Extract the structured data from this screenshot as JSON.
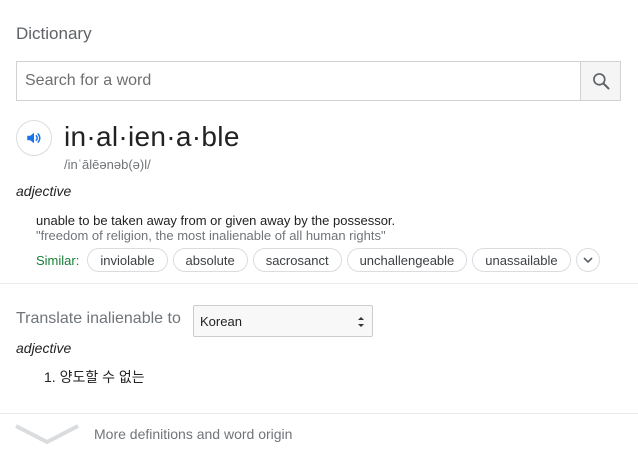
{
  "header": {
    "title": "Dictionary"
  },
  "search": {
    "placeholder": "Search for a word",
    "value": ""
  },
  "entry": {
    "word": "in·al·ien·a·ble",
    "phonetic": "/inˈālēənəb(ə)l/",
    "part_of_speech": "adjective",
    "definition": "unable to be taken away from or given away by the possessor.",
    "example": "\"freedom of religion, the most inalienable of all human rights\"",
    "similar_label": "Similar:",
    "similar": [
      "inviolable",
      "absolute",
      "sacrosanct",
      "unchallengeable",
      "unassailable"
    ]
  },
  "translate": {
    "label": "Translate inalienable to",
    "language": "Korean",
    "part_of_speech": "adjective",
    "items": [
      "1. 양도할 수 없는"
    ]
  },
  "footer": {
    "more_label": "More definitions and word origin"
  },
  "icons": {
    "search": "search-icon",
    "speaker": "speaker-icon",
    "expand": "chevron-down-icon",
    "select_arrows": "select-arrows-icon",
    "more": "chevron-down-icon"
  },
  "colors": {
    "similar_label": "#188038",
    "speaker": "#1a73e8"
  }
}
